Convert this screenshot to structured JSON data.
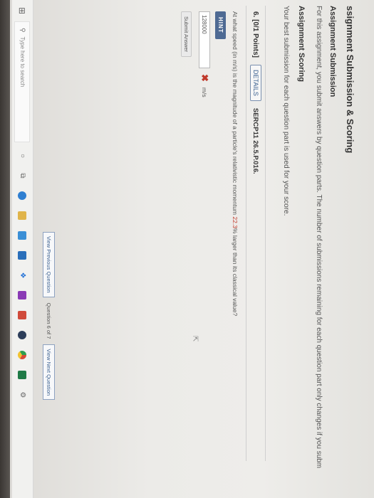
{
  "page": {
    "title": "ssignment Submission & Scoring",
    "submission_heading": "Assignment Submission",
    "submission_text": "For this assignment, you submit answers by question parts. The number of submissions remaining for each question part only changes if you subm",
    "scoring_heading": "Assignment Scoring",
    "scoring_text": "Your best submission for each question part is used for your score."
  },
  "question": {
    "number_label": "6.  [0/1 Points]",
    "details_label": "DETAILS",
    "code": "SERCP11 26.5.P.016.",
    "prompt_before": "At what speed (in m/s) is the magnitude of a particle's relativistic momentum ",
    "prompt_highlight": "22.3",
    "prompt_after": "% larger than its classical value?",
    "hint_label": "HINT",
    "answer_value": "128000",
    "incorrect_mark": "✖",
    "unit": "m/s",
    "submit_label": "Submit Answer"
  },
  "navigation": {
    "prev_label": "View Previous Question",
    "count_label": "Question 6 of 7",
    "next_label": "View Next Question"
  },
  "taskbar": {
    "search_placeholder": "Type here to search",
    "icons": [
      "windows-icon",
      "search-icon",
      "cortana-icon",
      "task-view-icon",
      "edge-icon",
      "file-explorer-icon",
      "store-icon",
      "mail-icon",
      "dropbox-icon",
      "onenote-icon",
      "app-icon",
      "steam-icon",
      "chrome-icon",
      "excel-icon",
      "settings-icon"
    ]
  },
  "colors": {
    "link_blue": "#3a5f8f",
    "hint_bg": "#4e6a93",
    "error_red": "#c0392b"
  }
}
